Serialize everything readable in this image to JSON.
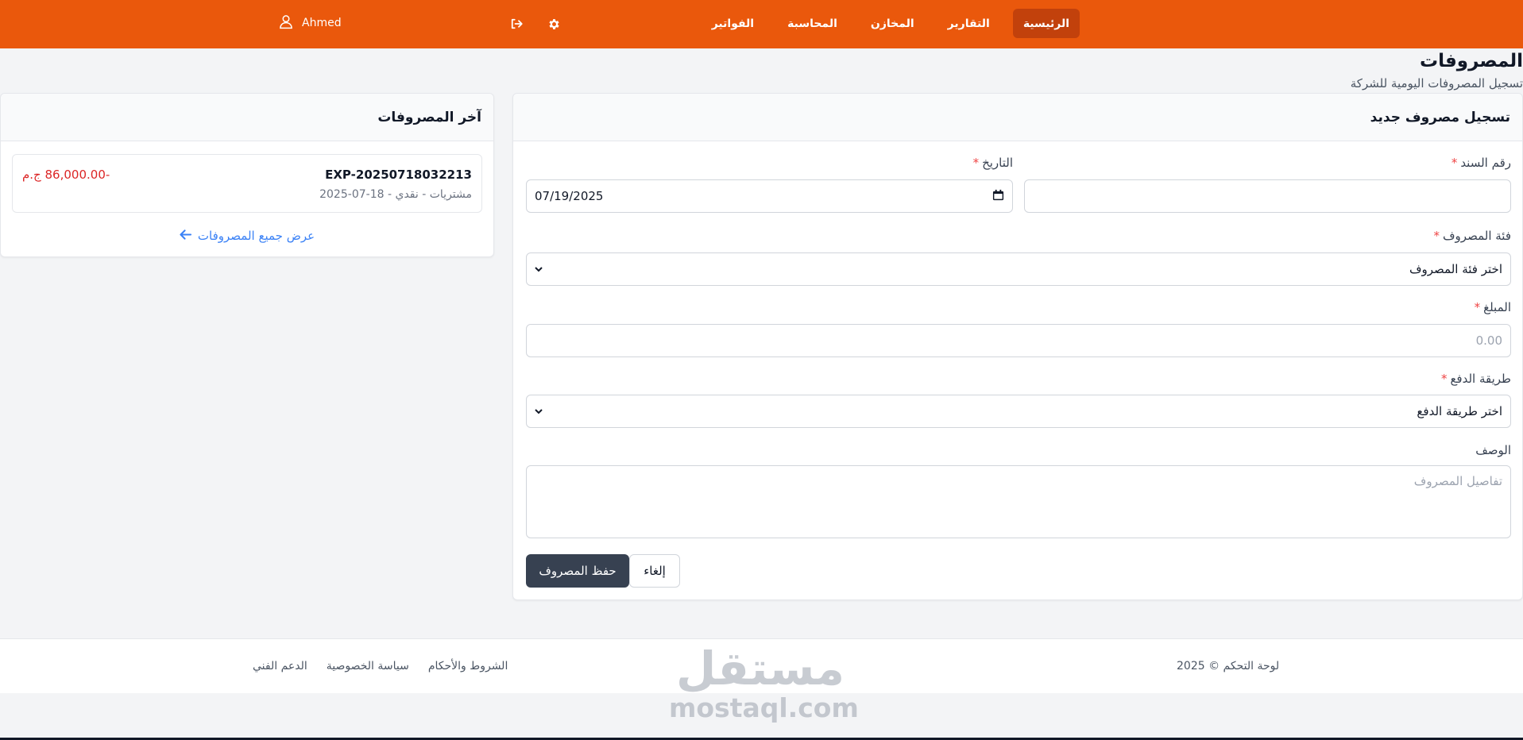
{
  "navbar": {
    "links": [
      "الرئيسية",
      "التقارير",
      "المخازن",
      "المحاسبة",
      "الفواتير"
    ],
    "active_index": 0,
    "user_name": "Ahmed"
  },
  "page": {
    "title": "المصروفات",
    "subtitle": "تسجيل المصروفات اليومية للشركة"
  },
  "form": {
    "header": "تسجيل مصروف جديد",
    "voucher_label": "رقم السند",
    "voucher_value": "",
    "date_label": "التاريخ",
    "date_value": "07/19/2025",
    "category_label": "فئة المصروف",
    "category_selected": "اختر فئة المصروف",
    "amount_label": "المبلغ",
    "amount_placeholder": "0.00",
    "payment_label": "طريقة الدفع",
    "payment_selected": "اختر طريقة الدفع",
    "description_label": "الوصف",
    "description_placeholder": "تفاصيل المصروف",
    "required_mark": "*",
    "save_label": "حفظ المصروف",
    "cancel_label": "إلغاء"
  },
  "recent": {
    "header": "آخر المصروفات",
    "items": [
      {
        "number": "EXP-20250718032213",
        "meta": "مشتريات - نقدي - 18-07-2025",
        "amount": "-86,000.00 ج.م"
      }
    ],
    "view_all": "عرض جميع المصروفات"
  },
  "footer": {
    "copyright": "لوحة التحكم © 2025",
    "links": [
      "الشروط والأحكام",
      "سياسة الخصوصية",
      "الدعم الفني"
    ]
  },
  "watermark": {
    "arabic": "مستقل",
    "latin": "mostaql.com"
  },
  "colors": {
    "navbar": "#ea580c",
    "nav_active": "#c2410c",
    "primary_button": "#374151",
    "amount_negative": "#dc2626",
    "link": "#3b82f6",
    "required": "#ef4444"
  },
  "icons": {
    "user": "user-icon",
    "logout": "logout-icon",
    "settings": "gear-icon",
    "calendar": "calendar-icon",
    "arrow": "arrow-left-icon",
    "chevron": "chevron-down-icon"
  }
}
